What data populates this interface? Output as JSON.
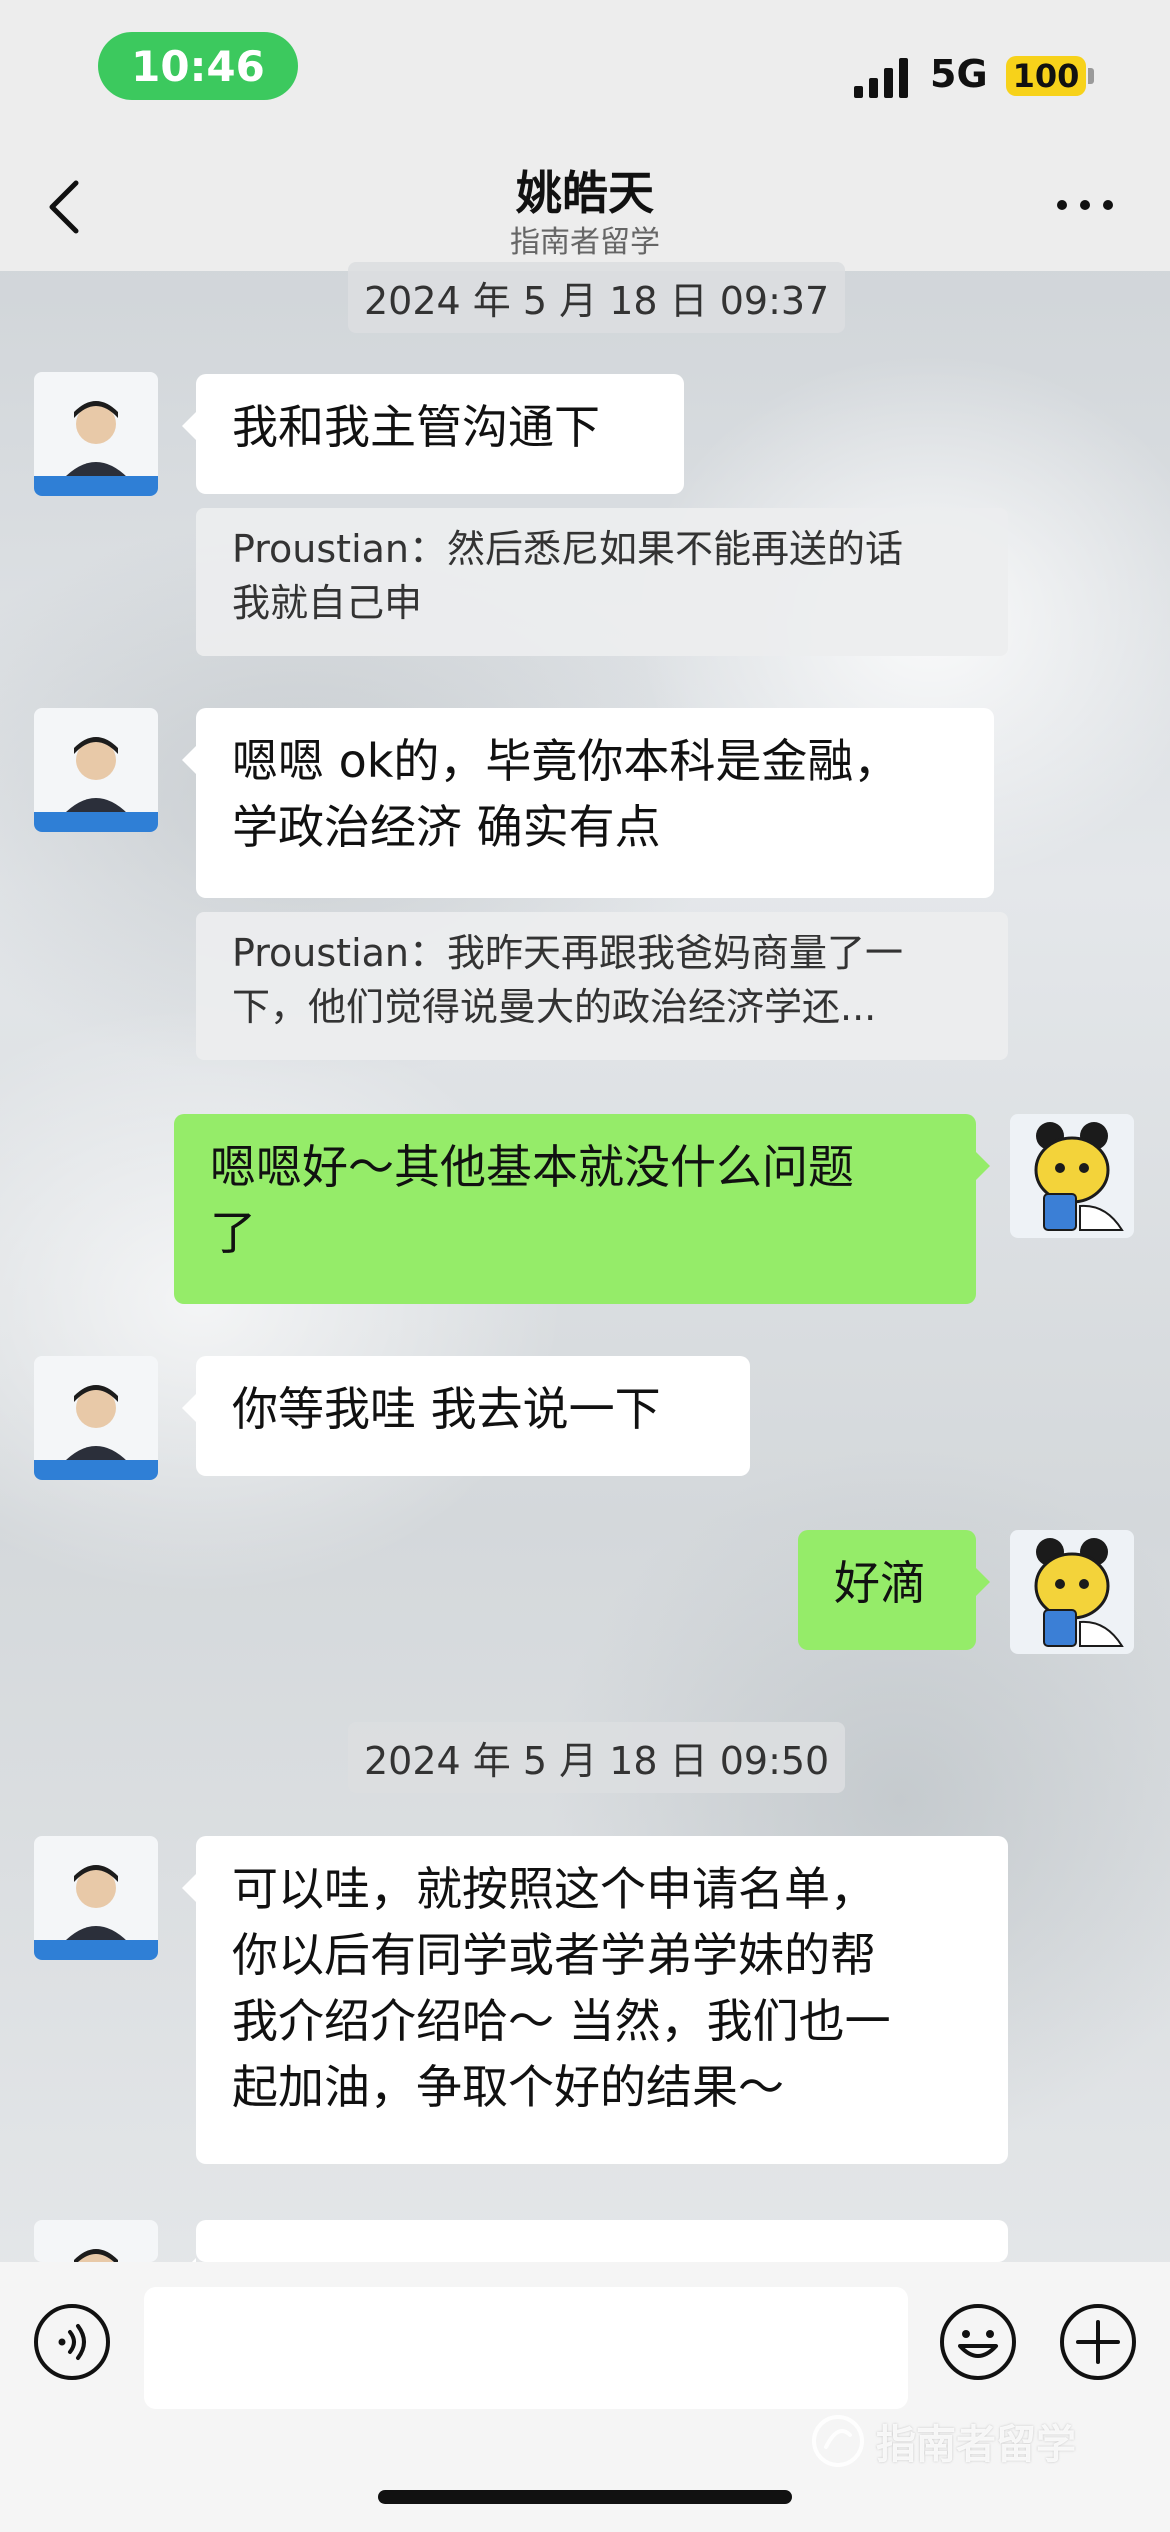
{
  "status_bar": {
    "time": "10:46",
    "network": "5G",
    "battery": "100",
    "colors": {
      "time_pill": "#3cc95e",
      "battery": "#f7d21a"
    }
  },
  "nav": {
    "title": "姚皓天",
    "subtitle": "指南者留学",
    "back_icon": "chevron-left-icon",
    "more_icon": "more-dots-icon"
  },
  "chat": {
    "timestamps": [
      "2024 年 5 月 18 日 09:37",
      "2024 年 5 月 18 日 09:50"
    ],
    "messages": [
      {
        "sender": "contact",
        "text": "我和我主管沟通下",
        "quote": {
          "author": "Proustian：",
          "text_line1": "然后悉尼如果不能再送的话",
          "text_line2": "我就自己申"
        }
      },
      {
        "sender": "contact",
        "line1": "嗯嗯 ok的，毕竟你本科是金融，",
        "line2": "学政治经济 确实有点",
        "quote": {
          "author": "Proustian：",
          "text_line1": "我昨天再跟我爸妈商量了一",
          "text_line2": "下，他们觉得说曼大的政治经济学还..."
        }
      },
      {
        "sender": "me",
        "line1": "嗯嗯好～其他基本就没什么问题",
        "line2": "了"
      },
      {
        "sender": "contact",
        "text": "你等我哇 我去说一下"
      },
      {
        "sender": "me",
        "text": "好滴"
      },
      {
        "sender": "contact",
        "line1": "可以哇，就按照这个申请名单，",
        "line2": "你以后有同学或者学弟学妹的帮",
        "line3": "我介绍介绍哈～ 当然，我们也一",
        "line4": "起加油，争取个好的结果～"
      }
    ],
    "colors": {
      "my_bubble": "#95ec69",
      "their_bubble": "#ffffff"
    }
  },
  "input_bar": {
    "voice_icon": "voice-icon",
    "emoji_icon": "emoji-icon",
    "plus_icon": "plus-icon",
    "watermark": "指南者留学"
  }
}
